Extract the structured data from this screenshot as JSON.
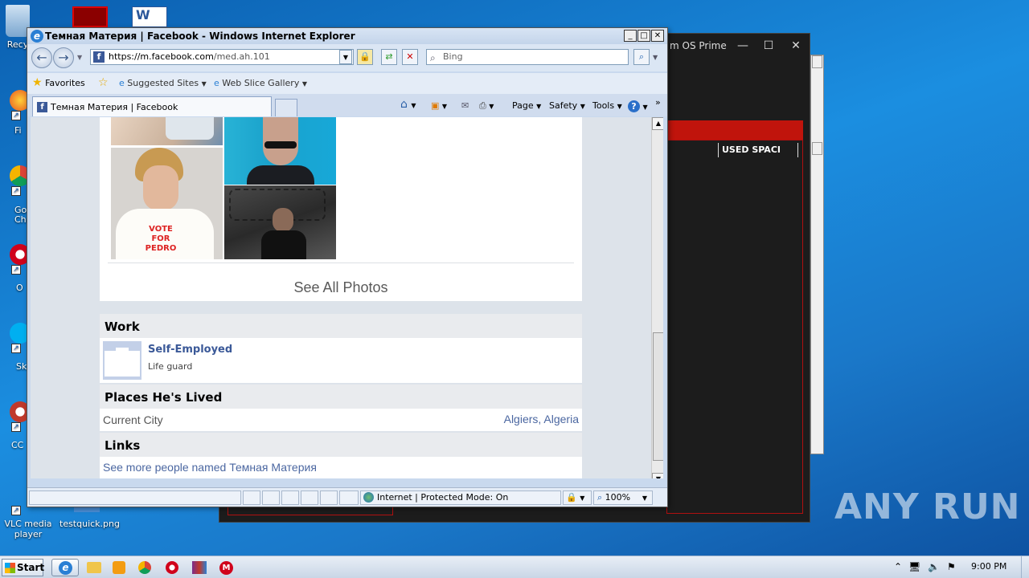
{
  "desktop": {
    "icons": [
      {
        "label": "Recy"
      },
      {
        "label": "Fi"
      },
      {
        "label": "Go Chr"
      },
      {
        "label": "O"
      },
      {
        "label": "Sk"
      },
      {
        "label": "CC"
      },
      {
        "label": "VLC media player"
      },
      {
        "label": "testquick.png"
      }
    ],
    "watermark": "ANY RUN"
  },
  "bg_window": {
    "title": "m OS Prime",
    "column_header": "USED SPACI"
  },
  "ie": {
    "title": "Темная Материя | Facebook - Windows Internet Explorer",
    "address": {
      "host": "https://m.facebook.com",
      "path": "/med.ah.101"
    },
    "search_placeholder": "Bing",
    "favorites": {
      "label": "Favorites",
      "suggested": "Suggested Sites",
      "gallery": "Web Slice Gallery"
    },
    "tab_title": "Темная Материя | Facebook",
    "commands": {
      "page": "Page",
      "safety": "Safety",
      "tools": "Tools",
      "help": "?"
    },
    "status": {
      "zone": "Internet | Protected Mode: On",
      "zoom": "100%"
    }
  },
  "fb": {
    "photos_link": "See All Photos",
    "photo_shirt_text": "VOTE FOR PEDRO",
    "work": {
      "heading": "Work",
      "employer": "Self-Employed",
      "position": "Life guard"
    },
    "places": {
      "heading": "Places He's Lived",
      "label": "Current City",
      "value": "Algiers, Algeria"
    },
    "links": {
      "heading": "Links",
      "more": "See more people named Темная Материя"
    }
  },
  "taskbar": {
    "start_label": "Start",
    "clock": "9:00 PM"
  }
}
